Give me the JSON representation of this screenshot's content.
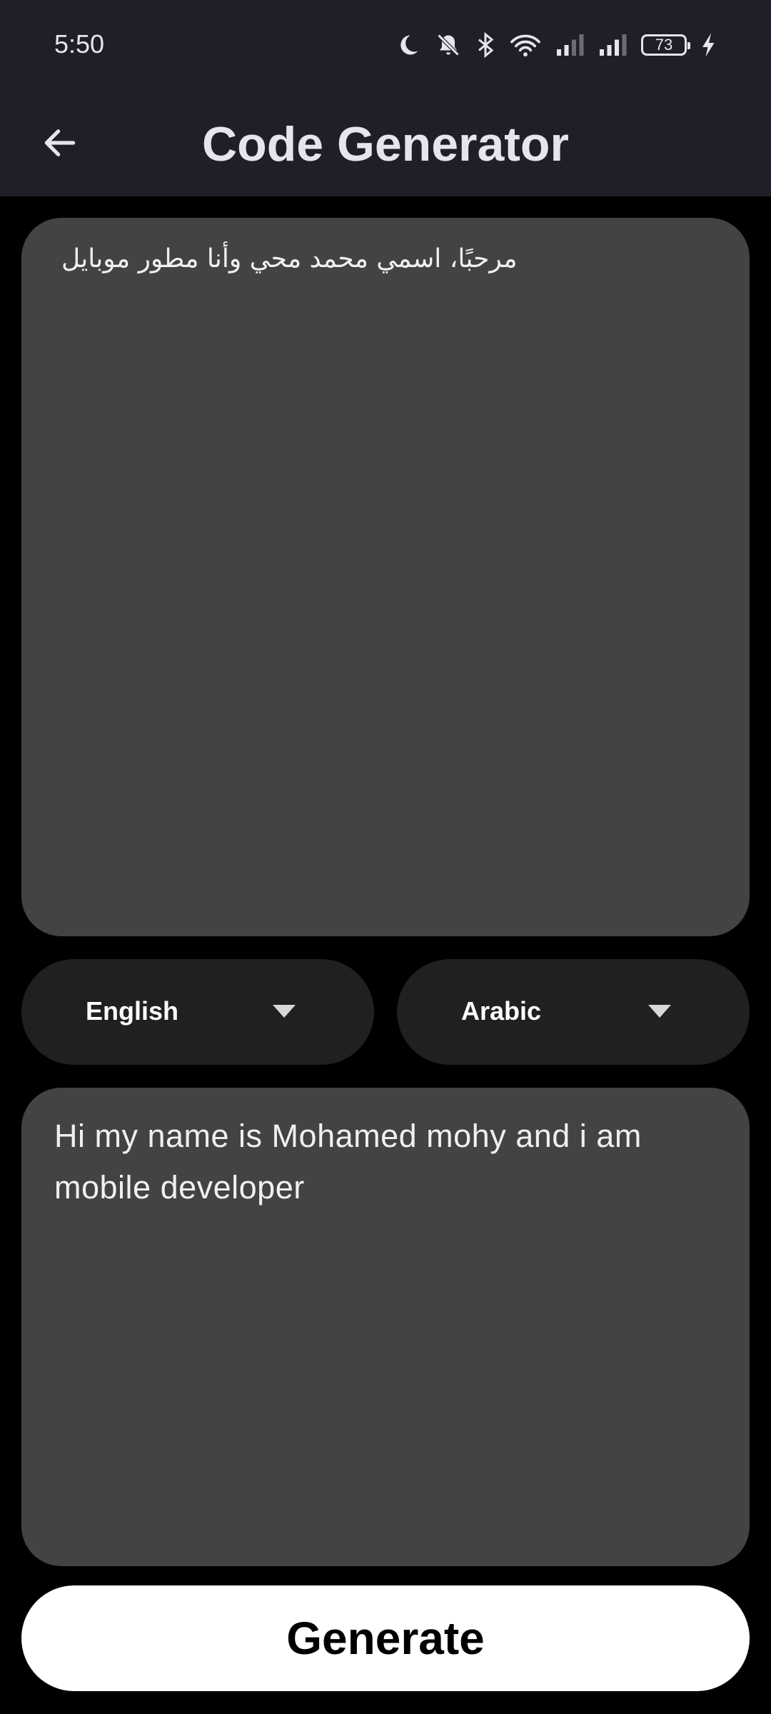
{
  "status_bar": {
    "time": "5:50",
    "battery_level": "73",
    "icons": [
      "moon-icon",
      "bell-off-icon",
      "bluetooth-icon",
      "wifi-icon",
      "signal-icon",
      "signal-icon",
      "battery-icon",
      "charging-icon"
    ]
  },
  "app_bar": {
    "title": "Code Generator",
    "back_icon": "arrow-left-icon"
  },
  "input": {
    "value": "مرحبًا، اسمي محمد محي وأنا مطور موبايل"
  },
  "languages": {
    "source": "English",
    "target": "Arabic"
  },
  "output": {
    "value": "Hi my name is Mohamed mohy and i am mobile developer"
  },
  "generate_button": {
    "label": "Generate"
  },
  "colors": {
    "bar_background": "#201f29",
    "page_background": "#000000",
    "text_box_background": "#434343",
    "dropdown_background": "#202020",
    "button_background": "#ffffff"
  }
}
